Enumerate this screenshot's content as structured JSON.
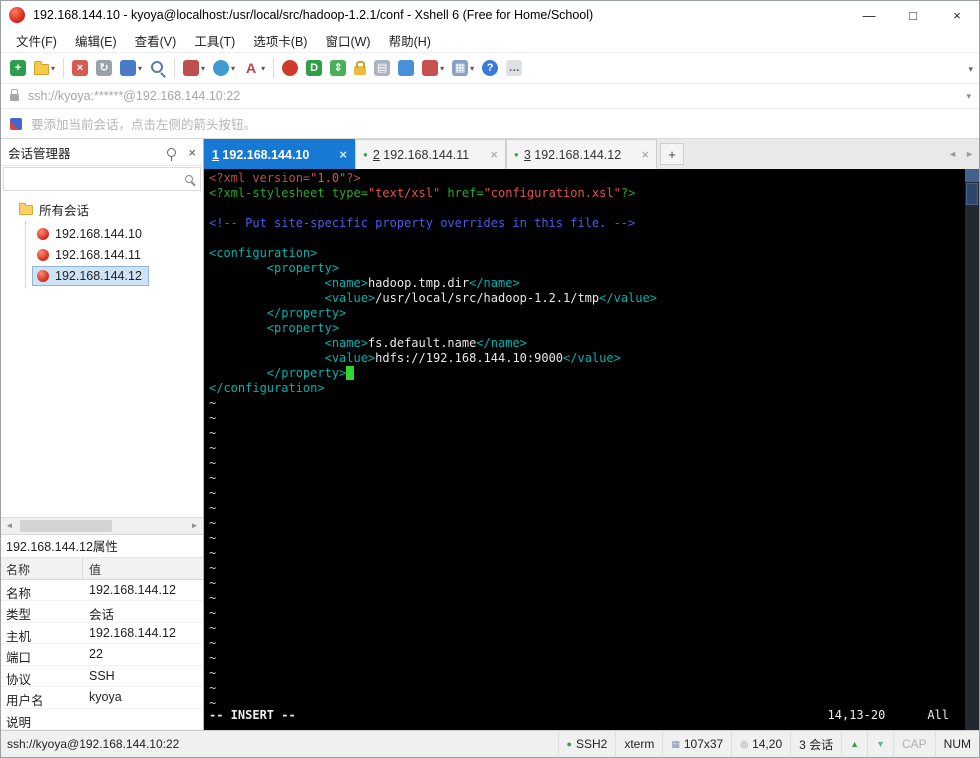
{
  "glyphs": {
    "caret": "▾",
    "close": "×",
    "dot": "●",
    "left": "◄",
    "right": "►",
    "minimize": "—",
    "maximize": "□"
  },
  "colors": {
    "accent": "#1679d4",
    "terminal_bg": "#000000",
    "decl": "#b5524c",
    "string": "#e0554f",
    "green": "#2aa82a",
    "comment": "#5157e8",
    "tag": "#00b2b2",
    "text": "#e8e8e8",
    "tilde": "#cccccc",
    "cursor": "#2fd42f"
  },
  "titlebar": {
    "title": "192.168.144.10 - kyoya@localhost:/usr/local/src/hadoop-1.2.1/conf - Xshell 6 (Free for Home/School)"
  },
  "menu": {
    "items": [
      "文件(F)",
      "编辑(E)",
      "查看(V)",
      "工具(T)",
      "选项卡(B)",
      "窗口(W)",
      "帮助(H)"
    ]
  },
  "toolbar": {
    "icons": [
      {
        "name": "new-terminal-button",
        "glyph": "+",
        "bg": "#2e9e4e"
      },
      {
        "name": "open-session-button",
        "shape": "folder",
        "caret": true
      },
      {
        "sep": true
      },
      {
        "name": "disconnect-button",
        "glyph": "×",
        "bg": "#d65b52"
      },
      {
        "name": "reconnect-button",
        "glyph": "↻",
        "bg": "#9aa2ab"
      },
      {
        "name": "new-window-button",
        "glyph": "",
        "bg": "#4a7ac8",
        "caret": true
      },
      {
        "name": "find-button",
        "shape": "magnifier"
      },
      {
        "sep": true
      },
      {
        "name": "compose-button",
        "glyph": "",
        "bg": "#c0504d",
        "caret": true
      },
      {
        "name": "encoding-button",
        "shape": "round",
        "bg": "#3f9ad0",
        "caret": true
      },
      {
        "name": "font-button",
        "shape": "plain",
        "glyph": "A",
        "fg": "#c04040",
        "caret": true
      },
      {
        "sep": true
      },
      {
        "name": "xshell-session-button",
        "shape": "round",
        "bg": "#d03a2a"
      },
      {
        "name": "xftp-button",
        "glyph": "D",
        "bg": "#2f9e44"
      },
      {
        "name": "fullscreen-button",
        "glyph": "⇕",
        "bg": "#48b058"
      },
      {
        "name": "lock-screen-button",
        "shape": "lock"
      },
      {
        "name": "virtual-keyboard-button",
        "glyph": "▤",
        "bg": "#aab2bc"
      },
      {
        "name": "highlight-pen-button",
        "glyph": "",
        "bg": "#4a90d8"
      },
      {
        "name": "tools-button",
        "glyph": "",
        "bg": "#c85050",
        "caret": true
      },
      {
        "name": "layout-button",
        "glyph": "▦",
        "bg": "#8aa0c4",
        "caret": true
      },
      {
        "name": "help-button",
        "shape": "round",
        "glyph": "?",
        "bg": "#3a7ad8"
      },
      {
        "name": "feedback-button",
        "glyph": "…",
        "bg": "#dde1e6",
        "fg": "#555555"
      }
    ]
  },
  "addressbar": {
    "value": "ssh://kyoya:******@192.168.144.10:22"
  },
  "infobar": {
    "text": "要添加当前会话，点击左侧的箭头按钮。"
  },
  "sidebar": {
    "title": "会话管理器",
    "tree_root": "所有会话",
    "sessions": [
      {
        "label": "192.168.144.10",
        "selected": false
      },
      {
        "label": "192.168.144.11",
        "selected": false
      },
      {
        "label": "192.168.144.12",
        "selected": true
      }
    ],
    "properties_title": "192.168.144.12属性",
    "table": {
      "headers": [
        "名称",
        "值"
      ],
      "rows": [
        [
          "名称",
          "192.168.144.12"
        ],
        [
          "类型",
          "会话"
        ],
        [
          "主机",
          "192.168.144.12"
        ],
        [
          "端口",
          "22"
        ],
        [
          "协议",
          "SSH"
        ],
        [
          "用户名",
          "kyoya"
        ],
        [
          "说明",
          ""
        ]
      ]
    }
  },
  "tabs": {
    "items": [
      {
        "num": "1",
        "host": "192.168.144.10",
        "active": true,
        "dot": false
      },
      {
        "num": "2",
        "host": "192.168.144.11",
        "active": false,
        "dot": true
      },
      {
        "num": "3",
        "host": "192.168.144.12",
        "active": false,
        "dot": true
      }
    ],
    "new_tab": "+"
  },
  "terminal": {
    "lines": [
      [
        {
          "t": "<?xml version=",
          "c": "decl"
        },
        {
          "t": "\"1.0\"",
          "c": "string"
        },
        {
          "t": "?>",
          "c": "decl"
        }
      ],
      [
        {
          "t": "<?xml-stylesheet type=",
          "c": "green"
        },
        {
          "t": "\"text/xsl\"",
          "c": "string"
        },
        {
          "t": " href=",
          "c": "green"
        },
        {
          "t": "\"configuration.xsl\"",
          "c": "string"
        },
        {
          "t": "?>",
          "c": "green"
        }
      ],
      [],
      [
        {
          "t": "<!-- Put site-specific property overrides in this file. -->",
          "c": "comment"
        }
      ],
      [],
      [
        {
          "t": "<configuration>",
          "c": "tag"
        }
      ],
      [
        {
          "t": "        <property>",
          "c": "tag"
        }
      ],
      [
        {
          "t": "                <name>",
          "c": "tag"
        },
        {
          "t": "hadoop.tmp.dir",
          "c": "text"
        },
        {
          "t": "</name>",
          "c": "tag"
        }
      ],
      [
        {
          "t": "                <value>",
          "c": "tag"
        },
        {
          "t": "/usr/local/src/hadoop-1.2.1/tmp",
          "c": "text"
        },
        {
          "t": "</value>",
          "c": "tag"
        }
      ],
      [
        {
          "t": "        </property>",
          "c": "tag"
        }
      ],
      [
        {
          "t": "        <property>",
          "c": "tag"
        }
      ],
      [
        {
          "t": "                <name>",
          "c": "tag"
        },
        {
          "t": "fs.default.name",
          "c": "text"
        },
        {
          "t": "</name>",
          "c": "tag"
        }
      ],
      [
        {
          "t": "                <value>",
          "c": "tag"
        },
        {
          "t": "hdfs://192.168.144.10:9000",
          "c": "text"
        },
        {
          "t": "</value>",
          "c": "tag"
        }
      ],
      [
        {
          "t": "        </property>",
          "c": "tag"
        },
        {
          "t": " ",
          "c": "cursor"
        }
      ],
      [
        {
          "t": "</configuration>",
          "c": "tag"
        }
      ]
    ],
    "tilde": "~",
    "tilde_count": 21,
    "status_mode": "-- INSERT --",
    "status_pos": "14,13-20",
    "status_scroll": "All"
  },
  "statusbar": {
    "left": "ssh://kyoya@192.168.144.10:22",
    "items": [
      {
        "name": "protocol-indicator",
        "icon": "ssh-status-icon",
        "glyph": "●",
        "icolor": "#2ea44f",
        "label": "SSH2"
      },
      {
        "name": "terminal-type-indicator",
        "label": "xterm"
      },
      {
        "name": "terminal-size-indicator",
        "icon": "size-icon",
        "glyph": "▦",
        "icolor": "#7a92b8",
        "label": "107x37"
      },
      {
        "name": "cursor-position-indicator",
        "icon": "position-icon",
        "glyph": "◎",
        "icolor": "#8a8a8a",
        "label": "14,20"
      },
      {
        "name": "session-count-indicator",
        "label": "3 会话"
      },
      {
        "name": "scroll-up-button",
        "icon": "up-arrow-icon",
        "glyph": "▲",
        "icolor": "#2ea44f",
        "inter": true
      },
      {
        "name": "scroll-down-button",
        "icon": "down-arrow-icon",
        "glyph": "▼",
        "icolor": "#69b58a",
        "inter": true
      },
      {
        "name": "caps-lock-indicator",
        "label": "CAP",
        "dim": true
      },
      {
        "name": "num-lock-indicator",
        "label": "NUM"
      }
    ]
  }
}
